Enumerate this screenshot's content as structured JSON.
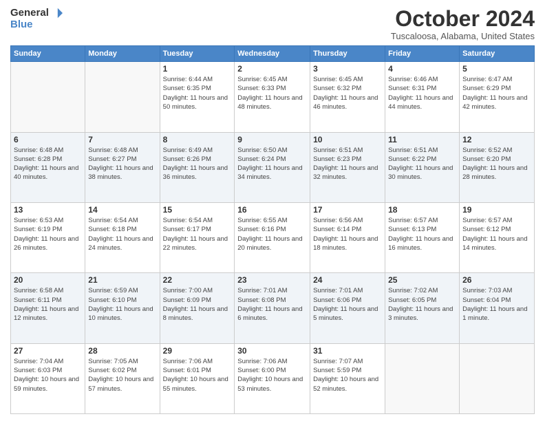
{
  "header": {
    "logo_line1": "General",
    "logo_line2": "Blue",
    "month_title": "October 2024",
    "location": "Tuscaloosa, Alabama, United States"
  },
  "weekdays": [
    "Sunday",
    "Monday",
    "Tuesday",
    "Wednesday",
    "Thursday",
    "Friday",
    "Saturday"
  ],
  "weeks": [
    [
      {
        "day": "",
        "info": ""
      },
      {
        "day": "",
        "info": ""
      },
      {
        "day": "1",
        "info": "Sunrise: 6:44 AM\nSunset: 6:35 PM\nDaylight: 11 hours and 50 minutes."
      },
      {
        "day": "2",
        "info": "Sunrise: 6:45 AM\nSunset: 6:33 PM\nDaylight: 11 hours and 48 minutes."
      },
      {
        "day": "3",
        "info": "Sunrise: 6:45 AM\nSunset: 6:32 PM\nDaylight: 11 hours and 46 minutes."
      },
      {
        "day": "4",
        "info": "Sunrise: 6:46 AM\nSunset: 6:31 PM\nDaylight: 11 hours and 44 minutes."
      },
      {
        "day": "5",
        "info": "Sunrise: 6:47 AM\nSunset: 6:29 PM\nDaylight: 11 hours and 42 minutes."
      }
    ],
    [
      {
        "day": "6",
        "info": "Sunrise: 6:48 AM\nSunset: 6:28 PM\nDaylight: 11 hours and 40 minutes."
      },
      {
        "day": "7",
        "info": "Sunrise: 6:48 AM\nSunset: 6:27 PM\nDaylight: 11 hours and 38 minutes."
      },
      {
        "day": "8",
        "info": "Sunrise: 6:49 AM\nSunset: 6:26 PM\nDaylight: 11 hours and 36 minutes."
      },
      {
        "day": "9",
        "info": "Sunrise: 6:50 AM\nSunset: 6:24 PM\nDaylight: 11 hours and 34 minutes."
      },
      {
        "day": "10",
        "info": "Sunrise: 6:51 AM\nSunset: 6:23 PM\nDaylight: 11 hours and 32 minutes."
      },
      {
        "day": "11",
        "info": "Sunrise: 6:51 AM\nSunset: 6:22 PM\nDaylight: 11 hours and 30 minutes."
      },
      {
        "day": "12",
        "info": "Sunrise: 6:52 AM\nSunset: 6:20 PM\nDaylight: 11 hours and 28 minutes."
      }
    ],
    [
      {
        "day": "13",
        "info": "Sunrise: 6:53 AM\nSunset: 6:19 PM\nDaylight: 11 hours and 26 minutes."
      },
      {
        "day": "14",
        "info": "Sunrise: 6:54 AM\nSunset: 6:18 PM\nDaylight: 11 hours and 24 minutes."
      },
      {
        "day": "15",
        "info": "Sunrise: 6:54 AM\nSunset: 6:17 PM\nDaylight: 11 hours and 22 minutes."
      },
      {
        "day": "16",
        "info": "Sunrise: 6:55 AM\nSunset: 6:16 PM\nDaylight: 11 hours and 20 minutes."
      },
      {
        "day": "17",
        "info": "Sunrise: 6:56 AM\nSunset: 6:14 PM\nDaylight: 11 hours and 18 minutes."
      },
      {
        "day": "18",
        "info": "Sunrise: 6:57 AM\nSunset: 6:13 PM\nDaylight: 11 hours and 16 minutes."
      },
      {
        "day": "19",
        "info": "Sunrise: 6:57 AM\nSunset: 6:12 PM\nDaylight: 11 hours and 14 minutes."
      }
    ],
    [
      {
        "day": "20",
        "info": "Sunrise: 6:58 AM\nSunset: 6:11 PM\nDaylight: 11 hours and 12 minutes."
      },
      {
        "day": "21",
        "info": "Sunrise: 6:59 AM\nSunset: 6:10 PM\nDaylight: 11 hours and 10 minutes."
      },
      {
        "day": "22",
        "info": "Sunrise: 7:00 AM\nSunset: 6:09 PM\nDaylight: 11 hours and 8 minutes."
      },
      {
        "day": "23",
        "info": "Sunrise: 7:01 AM\nSunset: 6:08 PM\nDaylight: 11 hours and 6 minutes."
      },
      {
        "day": "24",
        "info": "Sunrise: 7:01 AM\nSunset: 6:06 PM\nDaylight: 11 hours and 5 minutes."
      },
      {
        "day": "25",
        "info": "Sunrise: 7:02 AM\nSunset: 6:05 PM\nDaylight: 11 hours and 3 minutes."
      },
      {
        "day": "26",
        "info": "Sunrise: 7:03 AM\nSunset: 6:04 PM\nDaylight: 11 hours and 1 minute."
      }
    ],
    [
      {
        "day": "27",
        "info": "Sunrise: 7:04 AM\nSunset: 6:03 PM\nDaylight: 10 hours and 59 minutes."
      },
      {
        "day": "28",
        "info": "Sunrise: 7:05 AM\nSunset: 6:02 PM\nDaylight: 10 hours and 57 minutes."
      },
      {
        "day": "29",
        "info": "Sunrise: 7:06 AM\nSunset: 6:01 PM\nDaylight: 10 hours and 55 minutes."
      },
      {
        "day": "30",
        "info": "Sunrise: 7:06 AM\nSunset: 6:00 PM\nDaylight: 10 hours and 53 minutes."
      },
      {
        "day": "31",
        "info": "Sunrise: 7:07 AM\nSunset: 5:59 PM\nDaylight: 10 hours and 52 minutes."
      },
      {
        "day": "",
        "info": ""
      },
      {
        "day": "",
        "info": ""
      }
    ]
  ]
}
